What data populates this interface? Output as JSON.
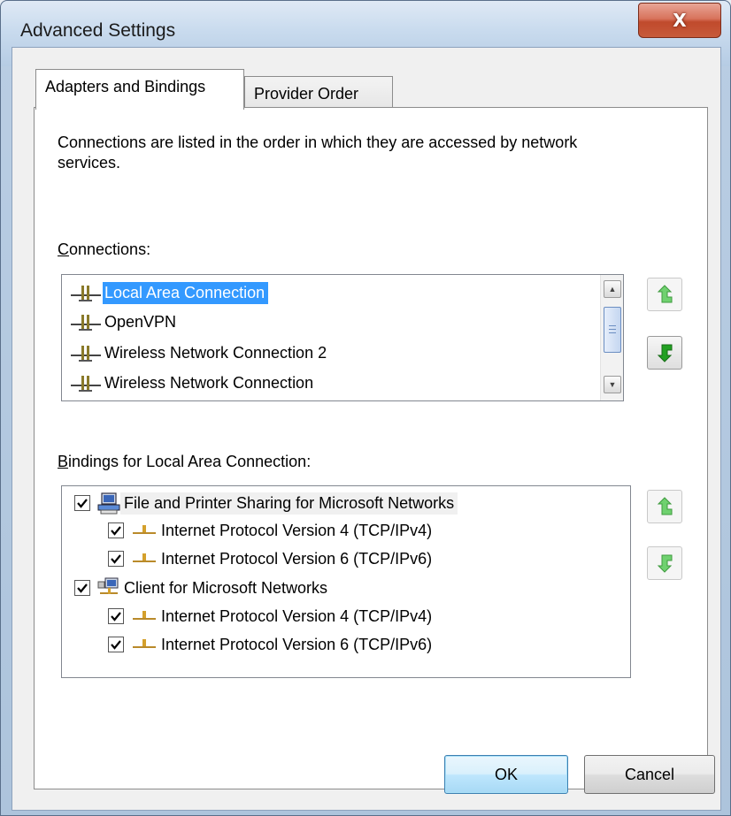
{
  "window": {
    "title": "Advanced Settings",
    "close_glyph": "X"
  },
  "tabs": [
    {
      "label": "Adapters and Bindings",
      "active": true
    },
    {
      "label": "Provider Order",
      "active": false
    }
  ],
  "description": "Connections are listed in the order in which they are accessed by network services.",
  "connections": {
    "label_access": "C",
    "label_rest": "onnections:",
    "items": [
      {
        "label": "Local Area Connection",
        "icon": "network-adapter-icon",
        "selected": true
      },
      {
        "label": "OpenVPN",
        "icon": "network-adapter-icon",
        "selected": false
      },
      {
        "label": "Wireless Network Connection 2",
        "icon": "network-adapter-icon",
        "selected": false
      },
      {
        "label": "Wireless Network Connection",
        "icon": "network-adapter-icon",
        "selected": false
      }
    ],
    "move_up_icon": "green-arrow-up-icon",
    "move_down_icon": "green-arrow-down-icon"
  },
  "bindings": {
    "label_access": "B",
    "label_rest": "indings for Local Area Connection:",
    "items": [
      {
        "label": "File and Printer Sharing for Microsoft Networks",
        "icon": "file-printer-sharing-icon",
        "checked": true,
        "level": 0
      },
      {
        "label": "Internet Protocol Version 4 (TCP/IPv4)",
        "icon": "protocol-icon",
        "checked": true,
        "level": 1
      },
      {
        "label": "Internet Protocol Version 6 (TCP/IPv6)",
        "icon": "protocol-icon",
        "checked": true,
        "level": 1
      },
      {
        "label": "Client for Microsoft Networks",
        "icon": "network-client-icon",
        "checked": true,
        "level": 0
      },
      {
        "label": "Internet Protocol Version 4 (TCP/IPv4)",
        "icon": "protocol-icon",
        "checked": true,
        "level": 1
      },
      {
        "label": "Internet Protocol Version 6 (TCP/IPv6)",
        "icon": "protocol-icon",
        "checked": true,
        "level": 1
      }
    ]
  },
  "buttons": {
    "ok": "OK",
    "cancel": "Cancel"
  }
}
